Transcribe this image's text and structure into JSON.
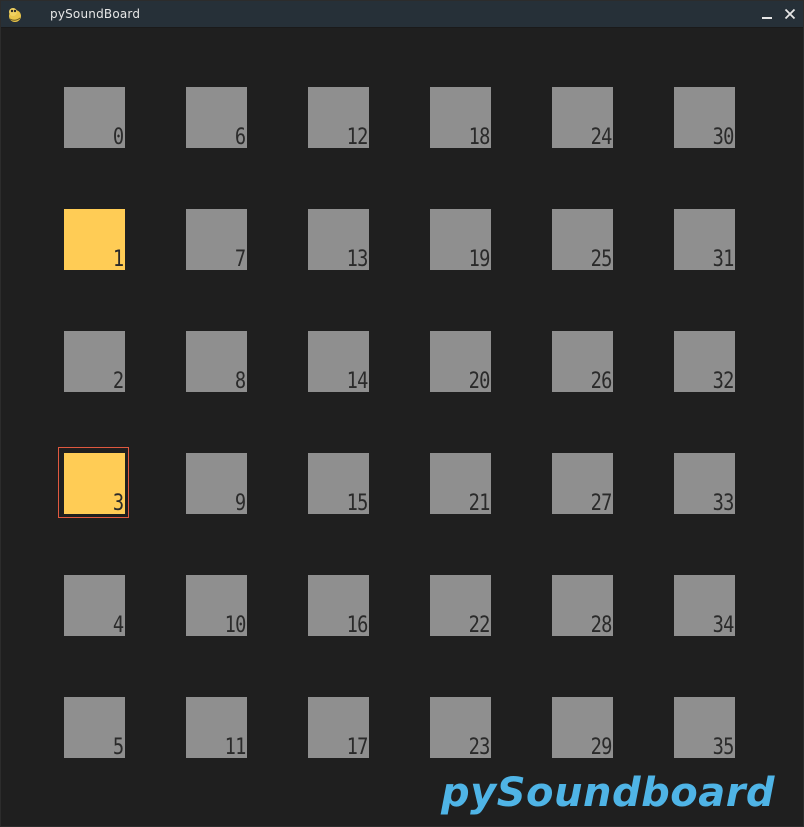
{
  "window": {
    "title": "pySoundBoard",
    "icons": {
      "app": "pygame-snake-icon",
      "minimize": "minimize-icon",
      "close": "close-icon"
    }
  },
  "colors": {
    "pad_default": "#8f8f8f",
    "pad_active": "#ffcc55",
    "selection_outline": "#e0583f",
    "logo": "#4fb4e6",
    "background": "#1f1f1f"
  },
  "board": {
    "pads": [
      {
        "label": "0",
        "active": false
      },
      {
        "label": "1",
        "active": true
      },
      {
        "label": "2",
        "active": false
      },
      {
        "label": "3",
        "active": true,
        "selected": true
      },
      {
        "label": "4",
        "active": false
      },
      {
        "label": "5",
        "active": false
      },
      {
        "label": "6",
        "active": false
      },
      {
        "label": "7",
        "active": false
      },
      {
        "label": "8",
        "active": false
      },
      {
        "label": "9",
        "active": false
      },
      {
        "label": "10",
        "active": false
      },
      {
        "label": "11",
        "active": false
      },
      {
        "label": "12",
        "active": false
      },
      {
        "label": "13",
        "active": false
      },
      {
        "label": "14",
        "active": false
      },
      {
        "label": "15",
        "active": false
      },
      {
        "label": "16",
        "active": false
      },
      {
        "label": "17",
        "active": false
      },
      {
        "label": "18",
        "active": false
      },
      {
        "label": "19",
        "active": false
      },
      {
        "label": "20",
        "active": false
      },
      {
        "label": "21",
        "active": false
      },
      {
        "label": "22",
        "active": false
      },
      {
        "label": "23",
        "active": false
      },
      {
        "label": "24",
        "active": false
      },
      {
        "label": "25",
        "active": false
      },
      {
        "label": "26",
        "active": false
      },
      {
        "label": "27",
        "active": false
      },
      {
        "label": "28",
        "active": false
      },
      {
        "label": "29",
        "active": false
      },
      {
        "label": "30",
        "active": false
      },
      {
        "label": "31",
        "active": false
      },
      {
        "label": "32",
        "active": false
      },
      {
        "label": "33",
        "active": false
      },
      {
        "label": "34",
        "active": false
      },
      {
        "label": "35",
        "active": false
      }
    ]
  },
  "logo": {
    "text": "pySoundboard"
  }
}
